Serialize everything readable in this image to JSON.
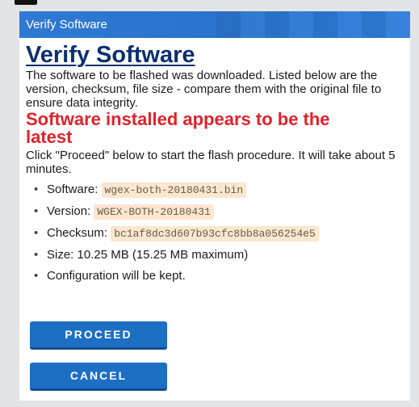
{
  "dialog": {
    "title": "Verify Software",
    "heading": "Verify Software",
    "intro": "The software to be flashed was downloaded. Listed below are the version, checksum, file size - compare them with the original file to ensure data integrity.",
    "warning": "Software installed appears to be the latest",
    "instruction": "Click \"Proceed\" below to start the flash procedure. It will take about 5 minutes.",
    "facts": {
      "software_label": "Software: ",
      "software_value": "wgex-both-20180431.bin",
      "version_label": "Version: ",
      "version_value": "WGEX-BOTH-20180431",
      "checksum_label": "Checksum: ",
      "checksum_value": "bc1af8dc3d607b93cfc8bb8a056254e5",
      "size_text": "Size: 10.25 MB (15.25 MB maximum)",
      "config_text": "Configuration will be kept."
    },
    "buttons": {
      "proceed": "PROCEED",
      "cancel": "CANCEL"
    },
    "colors": {
      "titlebar": "#2a76d0",
      "heading": "#0b2f6e",
      "warning": "#e0222a",
      "button": "#1d6fc4",
      "code_bg": "#fbe7cf"
    }
  }
}
